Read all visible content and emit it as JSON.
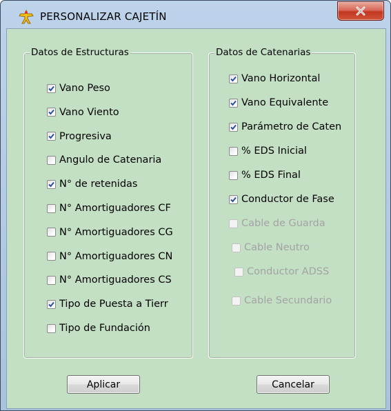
{
  "window": {
    "title": "PERSONALIZAR CAJETÍN",
    "icon": "yellow-figure-icon",
    "close_icon": "close-icon"
  },
  "groups": {
    "estructuras": {
      "legend": "Datos de Estructuras",
      "items": [
        {
          "label": "Vano Peso",
          "checked": true,
          "enabled": true
        },
        {
          "label": "Vano Viento",
          "checked": true,
          "enabled": true
        },
        {
          "label": "Progresiva",
          "checked": true,
          "enabled": true
        },
        {
          "label": "Angulo de Catenaria",
          "checked": false,
          "enabled": true
        },
        {
          "label": "N° de retenidas",
          "checked": true,
          "enabled": true
        },
        {
          "label": "N° Amortiguadores CF",
          "checked": false,
          "enabled": true
        },
        {
          "label": "N° Amortiguadores CG",
          "checked": false,
          "enabled": true
        },
        {
          "label": "N° Amortiguadores CN",
          "checked": false,
          "enabled": true
        },
        {
          "label": "N° Amortiguadores CS",
          "checked": false,
          "enabled": true
        },
        {
          "label": "Tipo de Puesta a Tierr",
          "checked": true,
          "enabled": true
        },
        {
          "label": "Tipo de Fundación",
          "checked": false,
          "enabled": true
        }
      ]
    },
    "catenarias": {
      "legend": "Datos de Catenarias",
      "items": [
        {
          "label": "Vano Horizontal",
          "checked": true,
          "enabled": true
        },
        {
          "label": "Vano Equivalente",
          "checked": true,
          "enabled": true
        },
        {
          "label": "Parámetro de Caten",
          "checked": true,
          "enabled": true
        },
        {
          "label": "% EDS Inicial",
          "checked": false,
          "enabled": true
        },
        {
          "label": "% EDS Final",
          "checked": false,
          "enabled": true
        },
        {
          "label": "Conductor de Fase",
          "checked": true,
          "enabled": true
        },
        {
          "label": "Cable de Guarda",
          "checked": false,
          "enabled": false
        },
        {
          "label": "Cable Neutro",
          "checked": false,
          "enabled": false
        },
        {
          "label": "Conductor ADSS",
          "checked": false,
          "enabled": false
        },
        {
          "label": "Cable Secundario",
          "checked": false,
          "enabled": false
        }
      ]
    }
  },
  "buttons": {
    "apply": "Aplicar",
    "cancel": "Cancelar"
  },
  "colors": {
    "client_background": "#c4e0c4",
    "check_mark": "#2a4fa0",
    "disabled_text": "#a3a3a3"
  }
}
